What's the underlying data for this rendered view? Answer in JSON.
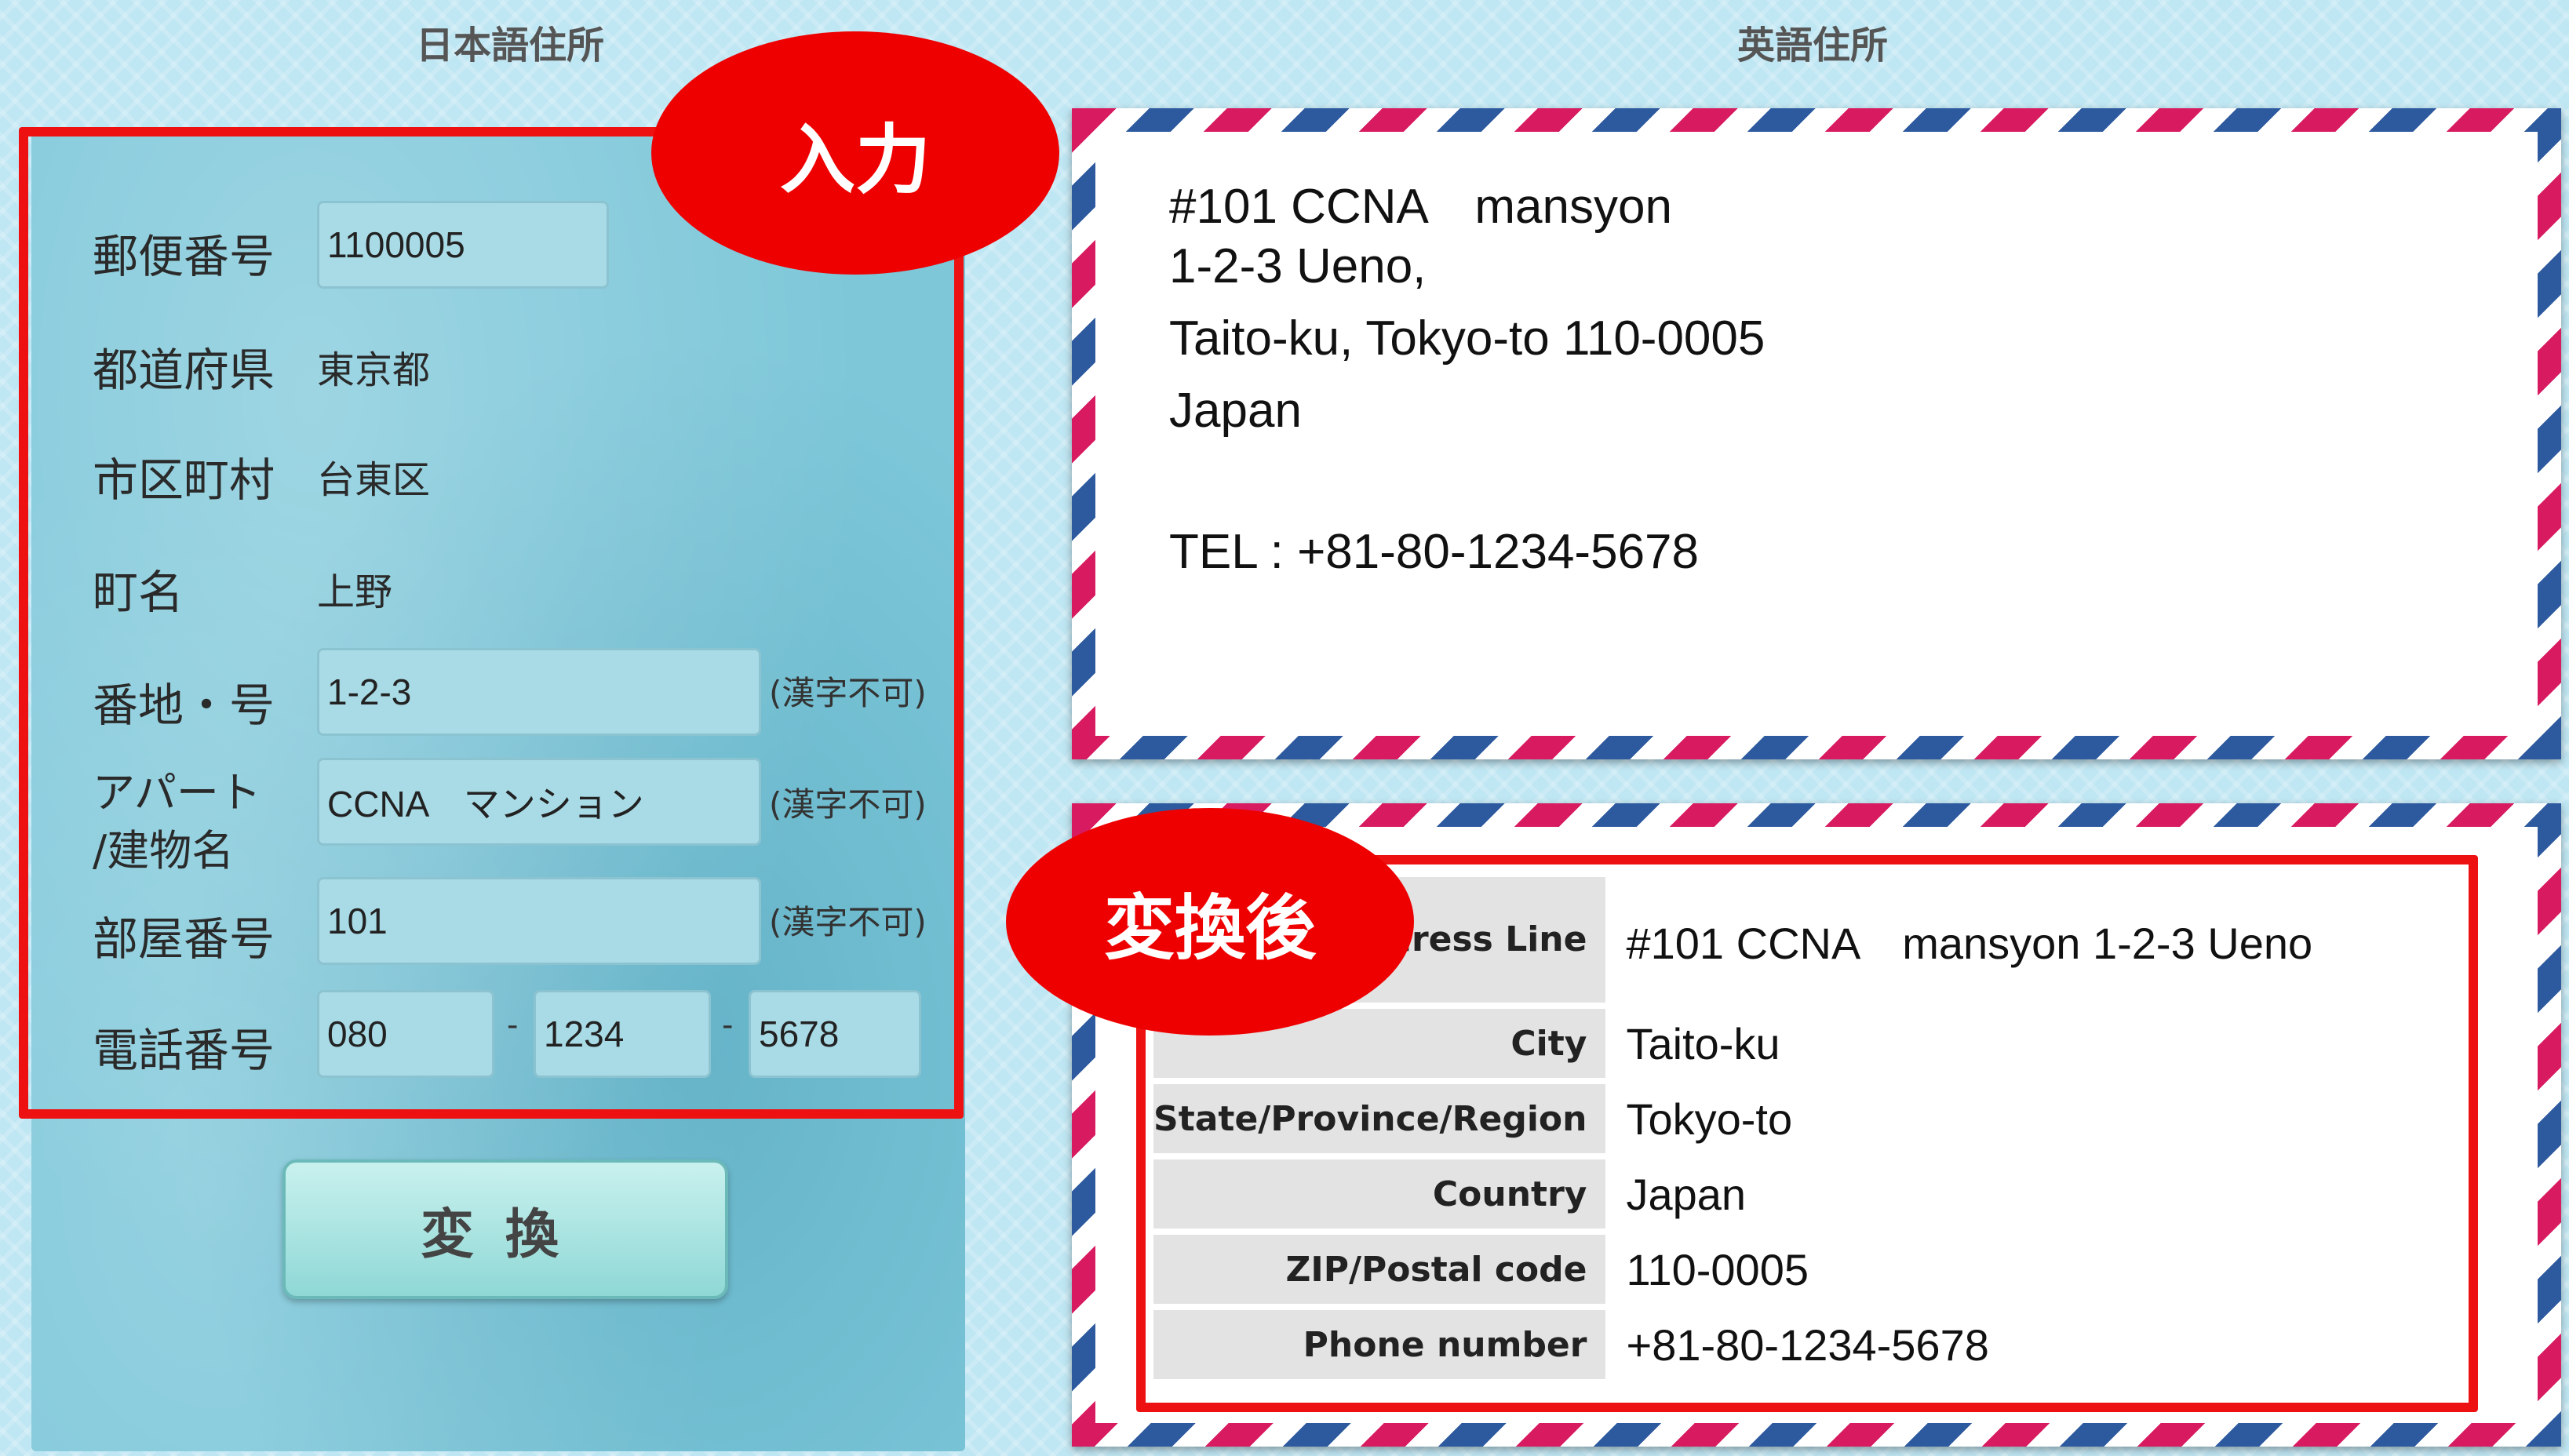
{
  "headings": {
    "japanese_address": "日本語住所",
    "english_address": "英語住所"
  },
  "callouts": {
    "input": "入力",
    "after_conversion": "変換後"
  },
  "form": {
    "postal_code": {
      "label": "郵便番号",
      "value": "1100005"
    },
    "prefecture": {
      "label": "都道府県",
      "value": "東京都"
    },
    "city": {
      "label": "市区町村",
      "value": "台東区"
    },
    "town": {
      "label": "町名",
      "value": "上野"
    },
    "block": {
      "label": "番地・号",
      "value": "1-2-3",
      "note": "(漢字不可)"
    },
    "building": {
      "label_line1": "アパート",
      "label_line2": "/建物名",
      "value": "CCNA　マンション",
      "note": "(漢字不可)"
    },
    "room": {
      "label": "部屋番号",
      "value": "101",
      "note": "(漢字不可)"
    },
    "phone": {
      "label": "電話番号",
      "part1": "080",
      "part2": "1234",
      "part3": "5678",
      "separator": "-"
    }
  },
  "convert_button": {
    "label": "変換"
  },
  "english_envelope": {
    "lines": [
      "#101 CCNA　mansyon",
      "1-2-3 Ueno,",
      "Taito-ku, Tokyo-to 110-0005",
      "Japan",
      "TEL : +81-80-1234-5678"
    ]
  },
  "converted_table": [
    {
      "key": "Address Line",
      "value": "#101 CCNA　mansyon 1-2-3 Ueno"
    },
    {
      "key": "City",
      "value": "Taito-ku"
    },
    {
      "key": "State/Province/Region",
      "value": "Tokyo-to"
    },
    {
      "key": "Country",
      "value": "Japan"
    },
    {
      "key": "ZIP/Postal code",
      "value": "110-0005"
    },
    {
      "key": "Phone number",
      "value": "+81-80-1234-5678"
    }
  ],
  "colors": {
    "highlight_red": "#ee1111",
    "panel_blue": "#7dc7d9",
    "airmail_red": "#d81b60",
    "airmail_blue": "#2d5a9e"
  }
}
